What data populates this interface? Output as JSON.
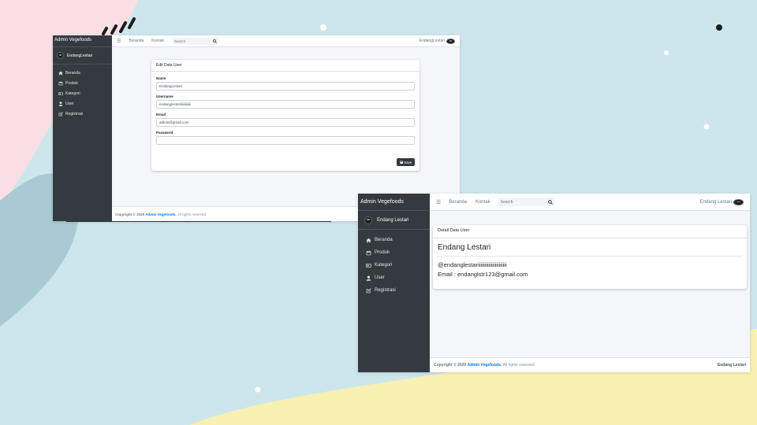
{
  "screen_left": {
    "brand": "Admin Vegefoods",
    "user_name": "EndangLestari",
    "nav": [
      {
        "label": "Beranda",
        "icon": "home-icon"
      },
      {
        "label": "Produk",
        "icon": "calendar-icon"
      },
      {
        "label": "Kategori",
        "icon": "card-icon"
      },
      {
        "label": "User",
        "icon": "user-icon"
      },
      {
        "label": "Registrasi",
        "icon": "edit-icon"
      }
    ],
    "topbar": {
      "links": [
        "Beranda",
        "Kontak"
      ],
      "search_placeholder": "Search",
      "user": "EndangLestari"
    },
    "card_title": "Edit Data User",
    "form": {
      "name_label": "Name",
      "name_value": "EndangLestari",
      "username_label": "Username",
      "username_value": "endanglestariiiiiiiiiiiiii",
      "email_label": "Email",
      "email_value": "admin@gmail.com",
      "password_label": "Password",
      "password_value": ""
    },
    "save_label": "Save",
    "footer": {
      "prefix": "Copyright © 2020",
      "brand": "Admin Vegefoods.",
      "suffix": "All rights reserved."
    }
  },
  "screen_right": {
    "brand": "Admin Vegefoods",
    "user_name": "Endang Lestari",
    "nav": [
      {
        "label": "Beranda",
        "icon": "home-icon"
      },
      {
        "label": "Produk",
        "icon": "calendar-icon"
      },
      {
        "label": "Kategori",
        "icon": "card-icon"
      },
      {
        "label": "User",
        "icon": "user-icon"
      },
      {
        "label": "Registrasi",
        "icon": "edit-icon"
      }
    ],
    "topbar": {
      "links": [
        "Beranda",
        "Kontak"
      ],
      "search_placeholder": "Search",
      "user": "Endang Lestari"
    },
    "card_title": "Detail Data User",
    "detail": {
      "name": "Endang Lestari",
      "username": "@endanglestariiiiiiiiiiiiiiiiiiiiii",
      "email": "Email : endanglstr123@gmail.com"
    },
    "footer": {
      "prefix": "Copyright © 2020",
      "brand": "Admin Vegefoods.",
      "suffix": "All rights reserved.",
      "right": "Endang Lestari"
    }
  },
  "colors": {
    "background": "#cde6ec",
    "pink_blob": "#f9dfe3",
    "teal_blob": "#a9c9d3",
    "yellow_blob": "#f8f1b2",
    "sidebar": "#343a40",
    "link_blue": "#007bff",
    "button_dark": "#343a40"
  }
}
